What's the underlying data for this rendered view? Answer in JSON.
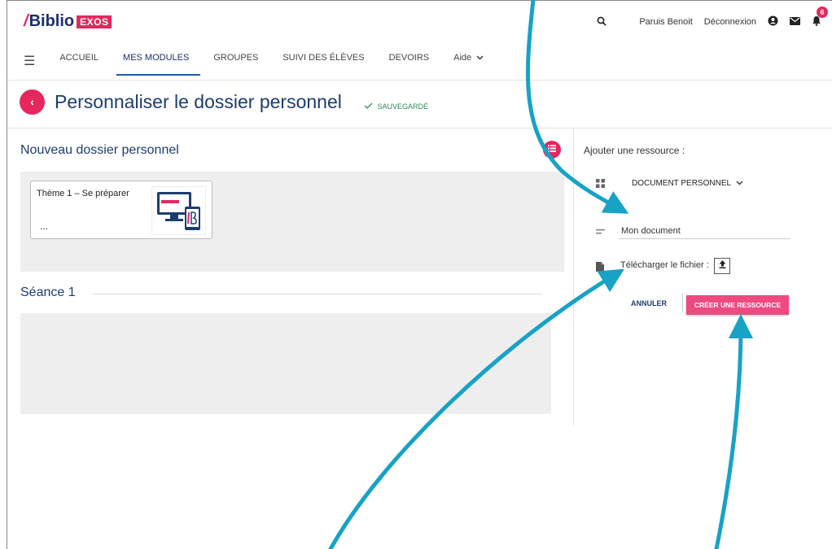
{
  "header": {
    "logo_main": "Biblio",
    "logo_tag": "EXOS",
    "user_name": "Paruis Benoit",
    "logout_label": "Déconnexion",
    "notification_count": "6"
  },
  "nav": {
    "items": [
      {
        "label": "ACCUEIL"
      },
      {
        "label": "MES MODULES"
      },
      {
        "label": "GROUPES"
      },
      {
        "label": "SUIVI DES ÉLÈVES"
      },
      {
        "label": "DEVOIRS"
      },
      {
        "label": "Aide"
      }
    ]
  },
  "page": {
    "title": "Personnaliser le dossier personnel",
    "saved_status": "SAUVEGARDÉ"
  },
  "folder": {
    "title": "Nouveau dossier personnel",
    "card_title": "Thème 1 – Se préparer",
    "card_dots": "...",
    "section_title": "Séance 1"
  },
  "resource_form": {
    "heading": "Ajouter une ressource :",
    "type_selected": "DOCUMENT PERSONNEL",
    "document_name_value": "Mon document",
    "upload_label": "Télécharger le fichier :",
    "cancel_label": "ANNULER",
    "create_label": "CRÉER UNE RESSOURCE"
  },
  "colors": {
    "accent": "#e5275d",
    "primary_text": "#1d3d6e",
    "arrow": "#17a2c6"
  }
}
